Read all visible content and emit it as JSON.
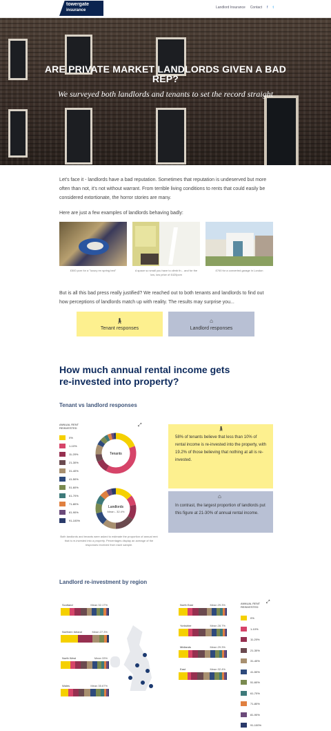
{
  "header": {
    "logo_line1": "towergate",
    "logo_line2": "insurance",
    "nav": [
      "Landlord Insurance",
      "Contact",
      "f",
      "t"
    ]
  },
  "hero": {
    "title": "ARE PRIVATE MARKET LANDLORDS GIVEN A BAD REP?",
    "subtitle": "We surveyed both landlords and tenants to set the record straight"
  },
  "intro": {
    "p1": "Let's face it - landlords have a bad reputation. Sometimes that reputation is undeserved but more often than not, it's not without warrant. From terrible living conditions to rents that could easily be considered extortionate, the horror stories are many.",
    "p2": "Here are just a few examples of landlords behaving badly:",
    "captions": [
      "£500 pcm for a \"luxury en spring bed\"",
      "A space so small you have to climb th... and for the low, low price of £420pcm",
      "£700 for a converted garage in London"
    ],
    "p3": "But is all this bad press really justified? We reached out to both tenants and landlords to find out how perceptions of landlords match up with reality. The results may surprise you..."
  },
  "buttons": {
    "tenant": "Tenant responses",
    "landlord": "Landlord responses"
  },
  "section": {
    "title": "How much annual rental income gets re-invested into property?",
    "sub1": "Tenant vs landlord responses",
    "sub2": "Landlord re-investment by region"
  },
  "legend": {
    "title": "ANNUAL RENT REINVESTED",
    "items": [
      {
        "label": "0%",
        "color": "#f5d000"
      },
      {
        "label": "1-10%",
        "color": "#d64469"
      },
      {
        "label": "11-20%",
        "color": "#963050"
      },
      {
        "label": "21-30%",
        "color": "#6b4a4f"
      },
      {
        "label": "31-40%",
        "color": "#a89070"
      },
      {
        "label": "41-50%",
        "color": "#2e4a7c"
      },
      {
        "label": "51-60%",
        "color": "#7a8a50"
      },
      {
        "label": "61-70%",
        "color": "#3e7a7a"
      },
      {
        "label": "71-80%",
        "color": "#e08040"
      },
      {
        "label": "81-90%",
        "color": "#6b4a7a"
      },
      {
        "label": "91-100%",
        "color": "#2a3a6a"
      }
    ]
  },
  "donuts": [
    {
      "label": "Tenants",
      "mean": "",
      "values": [
        19.2,
        38.8,
        10,
        6,
        8,
        4,
        4,
        3,
        3,
        2,
        2
      ]
    },
    {
      "label": "Landlords",
      "mean": "Mean - 32.4%",
      "values": [
        14,
        8,
        12,
        16,
        11,
        10,
        8,
        7,
        6,
        4,
        4
      ]
    }
  ],
  "facts": {
    "tenant": "58% of tenants believe that less than 10% of rental income is re-invested into the property, with 19.2% of those believing that nothing at all is re-invested.",
    "landlord": "In contrast, the largest proportion of landlords put this figure at 21-30% of annual rental income."
  },
  "note": "Both landlords and tenants were asked to estimate the proportion of annual rent that is re-invested into a property. Percentages display an average of the responses received from each sample.",
  "regions": [
    {
      "name": "Scotland",
      "mean": "Mean 32.17%",
      "values": [
        18,
        10,
        14,
        12,
        10,
        10,
        8,
        6,
        6,
        3,
        3
      ]
    },
    {
      "name": "Northern Ireland",
      "mean": "Mean 27.3%",
      "values": [
        35,
        0,
        30,
        0,
        15,
        0,
        10,
        0,
        5,
        0,
        5
      ]
    },
    {
      "name": "North West",
      "mean": "Mean 33%",
      "values": [
        20,
        10,
        12,
        12,
        12,
        10,
        8,
        6,
        5,
        3,
        2
      ]
    },
    {
      "name": "Wales",
      "mean": "Mean 35.67%",
      "values": [
        15,
        10,
        12,
        12,
        12,
        12,
        10,
        7,
        5,
        3,
        2
      ]
    },
    {
      "name": "North East",
      "mean": "Mean 29.3%",
      "values": [
        18,
        10,
        14,
        16,
        10,
        10,
        8,
        6,
        4,
        2,
        2
      ]
    },
    {
      "name": "Yorkshire",
      "mean": "Mean 28.7%",
      "values": [
        20,
        8,
        14,
        14,
        12,
        10,
        8,
        6,
        4,
        2,
        2
      ]
    },
    {
      "name": "Midlands",
      "mean": "Mean 29.3%",
      "values": [
        20,
        8,
        12,
        14,
        12,
        10,
        8,
        6,
        5,
        3,
        2
      ]
    },
    {
      "name": "East",
      "mean": "Mean 32.4%",
      "values": [
        18,
        8,
        12,
        14,
        12,
        10,
        10,
        6,
        5,
        3,
        2
      ]
    }
  ]
}
